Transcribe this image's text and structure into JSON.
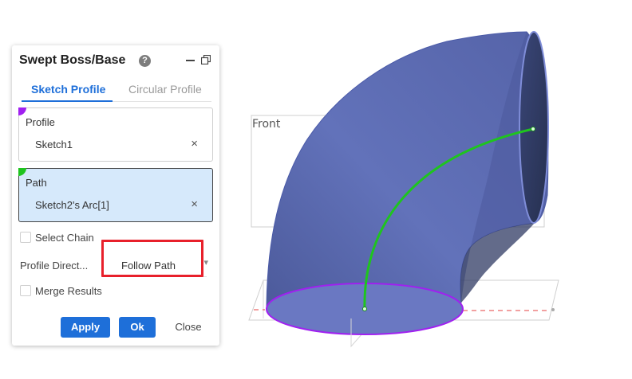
{
  "panel": {
    "title": "Swept Boss/Base",
    "help_glyph": "?",
    "tabs": [
      {
        "label": "Sketch Profile",
        "active": true
      },
      {
        "label": "Circular Profile",
        "active": false
      }
    ],
    "profile": {
      "label": "Profile",
      "value": "Sketch1",
      "tag_color": "#a020f0"
    },
    "path": {
      "label": "Path",
      "value": "Sketch2's Arc[1]",
      "tag_color": "#1fc41f"
    },
    "clear_glyph": "×",
    "select_chain": {
      "label": "Select Chain",
      "checked": false
    },
    "profile_direction": {
      "label": "Profile Direct...",
      "value": "Follow Path"
    },
    "merge_results": {
      "label": "Merge Results",
      "checked": false
    },
    "buttons": {
      "apply": "Apply",
      "ok": "Ok",
      "close": "Close"
    }
  },
  "viewport": {
    "plane_label": "Front",
    "colors": {
      "accent": "#1e6fd9",
      "highlight": "#e8202b",
      "sweep_path": "#1fc41f",
      "profile_edge": "#a020f0",
      "body": "#5f6db4"
    }
  }
}
